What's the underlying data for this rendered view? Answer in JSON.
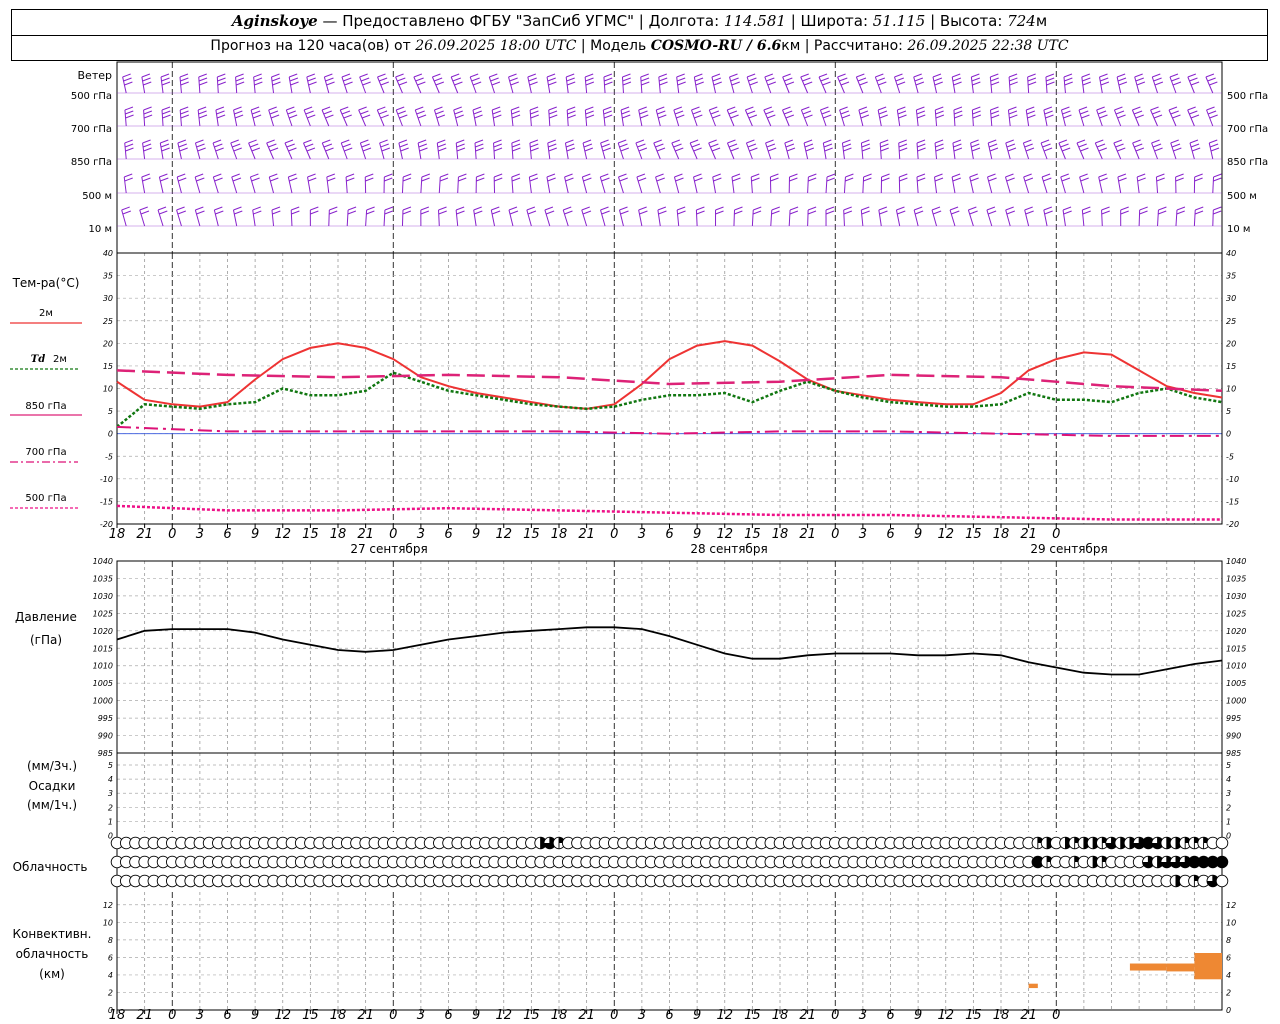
{
  "header": {
    "station": "Aginskoye",
    "provider": "— Предоставлено ФГБУ \"ЗапСиб УГМС\"",
    "lon_label": "Долгота:",
    "lon_value": "114.581",
    "lat_label": "Широта:",
    "lat_value": "51.115",
    "alt_label": "Высота:",
    "alt_value": "724",
    "alt_unit": "м",
    "forecast_label": "Прогноз на 120 часа(ов) от",
    "forecast_time": "26.09.2025 18:00 UTC",
    "model_label": "Модель",
    "model_name": "COSMO-RU / 6.6",
    "model_unit": "км",
    "calc_label": "Рассчитано:",
    "calc_time": "26.09.2025 22:38 UTC"
  },
  "labels": {
    "wind": "Ветер",
    "wind_levels": [
      "500 гПа",
      "700 гПа",
      "850 гПа",
      "500 м",
      "10 м"
    ],
    "temp": "Тем-ра(°С)",
    "legend_2m": "2м",
    "legend_td_a": "Td",
    "legend_td_b": "2м",
    "legend_850": "850 гПа",
    "legend_700": "700 гПа",
    "legend_500": "500 гПа",
    "pressure_a": "Давление",
    "pressure_b": "(гПа)",
    "precip_a": "(мм/3ч.)",
    "precip_b": "Осадки",
    "precip_c": "(мм/1ч.)",
    "clouds": "Облачность",
    "conv_a": "Конвективн.",
    "conv_b": "облачность",
    "conv_c": "(км)"
  },
  "axis": {
    "hour_labels": [
      "18",
      "21",
      "0",
      "3",
      "6",
      "9",
      "12",
      "15",
      "18",
      "21",
      "0",
      "3",
      "6",
      "9",
      "12",
      "15",
      "18",
      "21",
      "0",
      "3",
      "6",
      "9",
      "12",
      "15",
      "18",
      "21",
      "0",
      "3",
      "6",
      "9",
      "12",
      "15",
      "18",
      "21",
      "0"
    ],
    "date_labels": [
      "27 сентября",
      "28 сентября",
      "29 сентября"
    ],
    "temp_ticks": [
      "40",
      "35",
      "30",
      "25",
      "20",
      "15",
      "10",
      "5",
      "0",
      "-5",
      "-10",
      "-15",
      "-20"
    ],
    "pressure_ticks": [
      "1040",
      "1035",
      "1030",
      "1025",
      "1020",
      "1015",
      "1010",
      "1005",
      "1000",
      "995",
      "990",
      "985"
    ],
    "precip_ticks": [
      "5",
      "4",
      "3",
      "2",
      "1",
      "0"
    ],
    "conv_ticks": [
      "12",
      "10",
      "8",
      "6",
      "4",
      "2",
      "0"
    ]
  },
  "colors": {
    "temp_2m": "#ee3333",
    "dewpoint": "#117711",
    "t850": "#dd2277",
    "t700": "#dd1177",
    "t500": "#ee1188",
    "wind": "#8822cc",
    "pressure": "#000000",
    "convective": "#ee8833"
  },
  "chart_data": [
    {
      "type": "line",
      "panel": "temperature",
      "x_unit": "hours since 26.09.2025 18:00 UTC",
      "ylim": [
        -20,
        40
      ],
      "series": [
        {
          "name": "2м",
          "x": [
            0,
            3,
            6,
            9,
            12,
            15,
            18,
            21,
            24,
            27,
            30,
            33,
            36,
            39,
            42,
            45,
            48,
            51,
            54,
            57,
            60,
            63,
            66,
            69,
            72,
            75,
            78,
            81,
            84,
            87,
            90,
            93,
            96,
            99,
            102,
            105,
            108,
            111,
            114,
            117,
            120
          ],
          "values": [
            11.5,
            7.5,
            6.5,
            6,
            7,
            12,
            16.5,
            19,
            20,
            19,
            16.5,
            12.5,
            10.5,
            9,
            8,
            7,
            6,
            5.5,
            6.5,
            11,
            16.5,
            19.5,
            20.5,
            19.5,
            16,
            12,
            9.5,
            8.5,
            7.5,
            7,
            6.5,
            6.5,
            9,
            14,
            16.5,
            18,
            17.5,
            14,
            10.5,
            9,
            8
          ]
        },
        {
          "name": "Td 2м",
          "x": [
            0,
            3,
            6,
            9,
            12,
            15,
            18,
            21,
            24,
            27,
            30,
            33,
            36,
            39,
            42,
            45,
            48,
            51,
            54,
            57,
            60,
            63,
            66,
            69,
            72,
            75,
            78,
            81,
            84,
            87,
            90,
            93,
            96,
            99,
            102,
            105,
            108,
            111,
            114,
            117,
            120
          ],
          "values": [
            1.5,
            6.5,
            6,
            5.5,
            6.5,
            7,
            10,
            8.5,
            8.5,
            9.5,
            13.5,
            11.5,
            9.5,
            8.5,
            7.5,
            6.5,
            6,
            5.5,
            6,
            7.5,
            8.5,
            8.5,
            9,
            7,
            9.5,
            11.5,
            9.5,
            8,
            7,
            6.5,
            6,
            6,
            6.5,
            9,
            7.5,
            7.5,
            7,
            9,
            10,
            8,
            7
          ]
        },
        {
          "name": "850 гПа",
          "x": [
            0,
            12,
            24,
            36,
            48,
            60,
            72,
            84,
            96,
            108,
            120
          ],
          "values": [
            14,
            13,
            12.5,
            13,
            12.5,
            11,
            11.5,
            13,
            12.5,
            10.5,
            9.5
          ]
        },
        {
          "name": "700 гПа",
          "x": [
            0,
            12,
            24,
            36,
            48,
            60,
            72,
            84,
            96,
            108,
            120
          ],
          "values": [
            1.5,
            0.5,
            0.5,
            0.5,
            0.5,
            0,
            0.5,
            0.5,
            0,
            -0.5,
            -0.5
          ]
        },
        {
          "name": "500 гПа",
          "x": [
            0,
            12,
            24,
            36,
            48,
            60,
            72,
            84,
            96,
            108,
            120
          ],
          "values": [
            -16,
            -17,
            -17,
            -16.5,
            -17,
            -17.5,
            -18,
            -18,
            -18.5,
            -19,
            -19
          ]
        }
      ]
    },
    {
      "type": "line",
      "panel": "pressure",
      "x_unit": "hours since 26.09.2025 18:00 UTC",
      "ylim": [
        985,
        1040
      ],
      "series": [
        {
          "name": "Давление",
          "x": [
            0,
            3,
            6,
            9,
            12,
            15,
            18,
            21,
            24,
            27,
            30,
            33,
            36,
            39,
            42,
            45,
            48,
            51,
            54,
            57,
            60,
            63,
            66,
            69,
            72,
            75,
            78,
            81,
            84,
            87,
            90,
            93,
            96,
            99,
            102,
            105,
            108,
            111,
            114,
            117,
            120
          ],
          "values": [
            1017.5,
            1020,
            1020.5,
            1020.5,
            1020.5,
            1019.5,
            1017.5,
            1016,
            1014.5,
            1014,
            1014.5,
            1016,
            1017.5,
            1018.5,
            1019.5,
            1020,
            1020.5,
            1021,
            1021,
            1020.5,
            1018.5,
            1016,
            1013.5,
            1012,
            1012,
            1013,
            1013.5,
            1013.5,
            1013.5,
            1013,
            1013,
            1013.5,
            1013,
            1011,
            1009.5,
            1008,
            1007.5,
            1007.5,
            1009,
            1010.5,
            1011.5
          ]
        }
      ]
    },
    {
      "type": "bar",
      "panel": "convective_clouds",
      "ylim": [
        0,
        13
      ],
      "bars": [
        {
          "start_h": 99,
          "end_h": 100,
          "base_km": 2.5,
          "top_km": 3.0
        },
        {
          "start_h": 110,
          "end_h": 114,
          "base_km": 4.5,
          "top_km": 5.3
        },
        {
          "start_h": 114,
          "end_h": 117,
          "base_km": 4.4,
          "top_km": 5.3
        },
        {
          "start_h": 117,
          "end_h": 120,
          "base_km": 3.5,
          "top_km": 6.5
        }
      ]
    }
  ],
  "clouds": {
    "rows": [
      [
        0,
        0,
        0,
        0,
        0,
        0,
        0,
        0,
        0,
        0,
        0,
        0,
        0,
        0,
        0,
        0,
        0,
        0,
        0,
        0,
        0,
        0,
        0,
        0,
        0,
        0,
        0,
        0,
        0,
        0,
        0,
        0,
        0,
        0,
        0,
        0,
        0,
        0,
        0,
        0,
        0,
        0,
        0,
        0,
        0,
        0,
        0,
        0,
        0,
        0,
        0,
        0,
        0,
        0,
        0,
        0,
        0,
        0,
        0,
        0,
        0,
        0,
        0,
        0,
        0,
        0,
        0,
        0,
        0,
        0,
        0,
        0,
        0,
        0,
        0,
        0,
        0,
        0,
        0,
        0,
        0,
        0,
        0,
        0,
        0,
        0,
        0,
        0,
        0,
        0,
        0,
        0,
        0,
        0,
        0,
        0,
        0,
        0,
        0,
        0,
        0,
        0,
        0,
        0,
        0,
        0,
        0,
        0,
        0,
        0,
        0,
        0,
        0,
        0,
        0,
        0,
        0,
        0,
        0,
        0,
        0
      ],
      [
        0,
        0,
        0,
        0,
        0,
        0,
        0,
        0,
        0,
        0,
        0,
        0,
        0,
        0,
        0,
        0,
        0,
        0,
        0,
        0,
        0,
        0,
        0,
        0,
        0,
        0,
        0,
        0,
        0,
        0,
        0,
        0,
        0,
        0,
        0,
        0,
        0,
        0,
        0,
        0,
        0,
        0,
        0,
        0,
        0,
        0,
        0,
        0,
        0,
        0,
        0,
        0,
        0,
        0,
        0,
        0,
        0,
        0,
        0,
        0,
        0,
        0,
        0,
        0,
        0,
        0,
        0,
        0,
        0,
        0,
        0,
        0,
        0,
        0,
        0,
        0,
        0,
        0,
        0,
        0,
        0,
        0,
        0,
        0,
        0,
        0,
        0,
        0,
        0,
        0,
        0,
        0,
        0,
        0,
        0,
        0,
        0,
        0,
        0,
        0,
        0,
        0,
        0,
        0,
        0,
        0,
        0,
        0,
        0,
        0,
        0,
        0,
        0,
        0,
        0,
        0,
        0,
        0,
        0,
        0,
        0
      ],
      [
        0,
        0,
        0,
        0,
        0,
        0,
        0,
        0,
        0,
        0,
        0,
        0,
        0,
        0,
        0,
        0,
        0,
        0,
        0,
        0,
        0,
        0,
        0,
        0,
        0,
        0,
        0,
        0,
        0,
        0,
        0,
        0,
        0,
        0,
        0,
        0,
        0,
        0,
        0,
        0,
        0,
        0,
        0,
        0,
        0,
        0,
        0,
        0,
        0,
        0,
        0,
        0,
        0,
        0,
        0,
        0,
        0,
        0,
        0,
        0,
        0,
        0,
        0,
        0,
        0,
        0,
        0,
        0,
        0,
        0,
        0,
        0,
        0,
        0,
        0,
        0,
        0,
        0,
        0,
        0,
        0,
        0,
        0,
        0,
        0,
        0,
        0,
        0,
        0,
        0,
        0,
        0,
        0,
        0,
        0,
        0,
        0,
        0,
        0,
        0,
        0,
        0,
        0,
        0,
        0,
        0,
        0,
        0,
        0,
        0,
        0,
        0,
        0,
        0,
        0,
        0,
        0,
        0,
        0,
        0,
        0
      ]
    ],
    "overrides": [
      {
        "row": 0,
        "h": 46,
        "v": 0.5
      },
      {
        "row": 0,
        "h": 47,
        "v": 0.75
      },
      {
        "row": 0,
        "h": 48,
        "v": 0.25
      },
      {
        "row": 0,
        "h": 100,
        "v": 0.25
      },
      {
        "row": 0,
        "h": 101,
        "v": 0.5
      },
      {
        "row": 0,
        "h": 103,
        "v": 0.5
      },
      {
        "row": 0,
        "h": 104,
        "v": 0.25
      },
      {
        "row": 0,
        "h": 105,
        "v": 0.5
      },
      {
        "row": 0,
        "h": 106,
        "v": 0.5
      },
      {
        "row": 0,
        "h": 107,
        "v": 0.25
      },
      {
        "row": 0,
        "h": 108,
        "v": 0.75
      },
      {
        "row": 0,
        "h": 109,
        "v": 0.5
      },
      {
        "row": 0,
        "h": 110,
        "v": 0.5
      },
      {
        "row": 0,
        "h": 111,
        "v": 0.75
      },
      {
        "row": 0,
        "h": 112,
        "v": 1
      },
      {
        "row": 0,
        "h": 113,
        "v": 0.75
      },
      {
        "row": 0,
        "h": 114,
        "v": 0.5
      },
      {
        "row": 0,
        "h": 115,
        "v": 0.5
      },
      {
        "row": 0,
        "h": 116,
        "v": 0.25
      },
      {
        "row": 0,
        "h": 117,
        "v": 0.25
      },
      {
        "row": 0,
        "h": 118,
        "v": 0.25
      },
      {
        "row": 1,
        "h": 100,
        "v": 1
      },
      {
        "row": 1,
        "h": 101,
        "v": 0.25
      },
      {
        "row": 1,
        "h": 104,
        "v": 0.25
      },
      {
        "row": 1,
        "h": 106,
        "v": 0.5
      },
      {
        "row": 1,
        "h": 107,
        "v": 0.25
      },
      {
        "row": 1,
        "h": 112,
        "v": 0.75
      },
      {
        "row": 1,
        "h": 113,
        "v": 0.5
      },
      {
        "row": 1,
        "h": 114,
        "v": 0.75
      },
      {
        "row": 1,
        "h": 115,
        "v": 0.75
      },
      {
        "row": 1,
        "h": 116,
        "v": 0.75
      },
      {
        "row": 1,
        "h": 117,
        "v": 1
      },
      {
        "row": 1,
        "h": 118,
        "v": 1
      },
      {
        "row": 1,
        "h": 119,
        "v": 1
      },
      {
        "row": 1,
        "h": 120,
        "v": 1
      },
      {
        "row": 2,
        "h": 115,
        "v": 0.5
      },
      {
        "row": 2,
        "h": 117,
        "v": 0.25
      },
      {
        "row": 2,
        "h": 119,
        "v": 0.75
      }
    ]
  }
}
